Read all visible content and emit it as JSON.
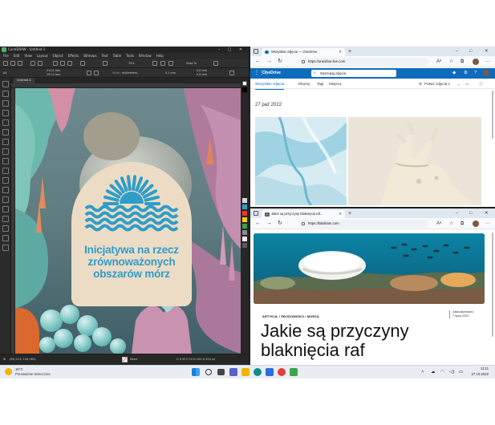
{
  "coreldraw": {
    "title": "CorelDRAW - Untitled-1",
    "menu": [
      "File",
      "Edit",
      "View",
      "Layout",
      "Object",
      "Effects",
      "Bitmaps",
      "Text",
      "Table",
      "Tools",
      "Window",
      "Help"
    ],
    "zoom": "75%",
    "snap_to": "Snap To",
    "page_size": "A4",
    "width": "210,0 mm",
    "height": "297,0 mm",
    "units": "millimeters",
    "nudge": "0,1 mm",
    "dup_x": "5,0 mm",
    "dup_y": "5,0 mm",
    "doc_tab": "Untitled-1",
    "status_left": "(64,114; 143,063)",
    "fill_label": "None",
    "status_right": "C:0 M:0 Y:0 K:100 0,500 pt",
    "artwork": {
      "title_lines": [
        "Inicjatywa na rzecz",
        "zrównoważonych",
        "obszarów mórz"
      ],
      "logo_color": "#2e9dc9"
    }
  },
  "onedrive_window": {
    "tab_title": "Wszystkie zdjęcia — OneDrive",
    "url": "https://onedrive.live.com",
    "brand": "OneDrive",
    "search_placeholder": "Wyszukaj zdjęcia",
    "tabs": [
      "Wszystkie zdjęcia",
      "Albumy",
      "Tagi",
      "Miejsca"
    ],
    "view_label": "Pokaż zdjęcia z",
    "date": "27 paź 2022"
  },
  "article_window": {
    "tab_title": "Jakie są przyczyny blaknięcia raf...",
    "url": "https://fabrikam.com",
    "categories": "ARTYKUŁ / ŚRODOWISKO / MORZA",
    "updated_label": "Zaktualizowano",
    "updated_date": "7 lipca 2022",
    "headline": "Jakie są przyczyny blaknięcia raf"
  },
  "taskbar": {
    "temperature": "16°C",
    "weather": "Przeważnie słonecznie",
    "time": "11:11",
    "date": "27.10.2022"
  }
}
